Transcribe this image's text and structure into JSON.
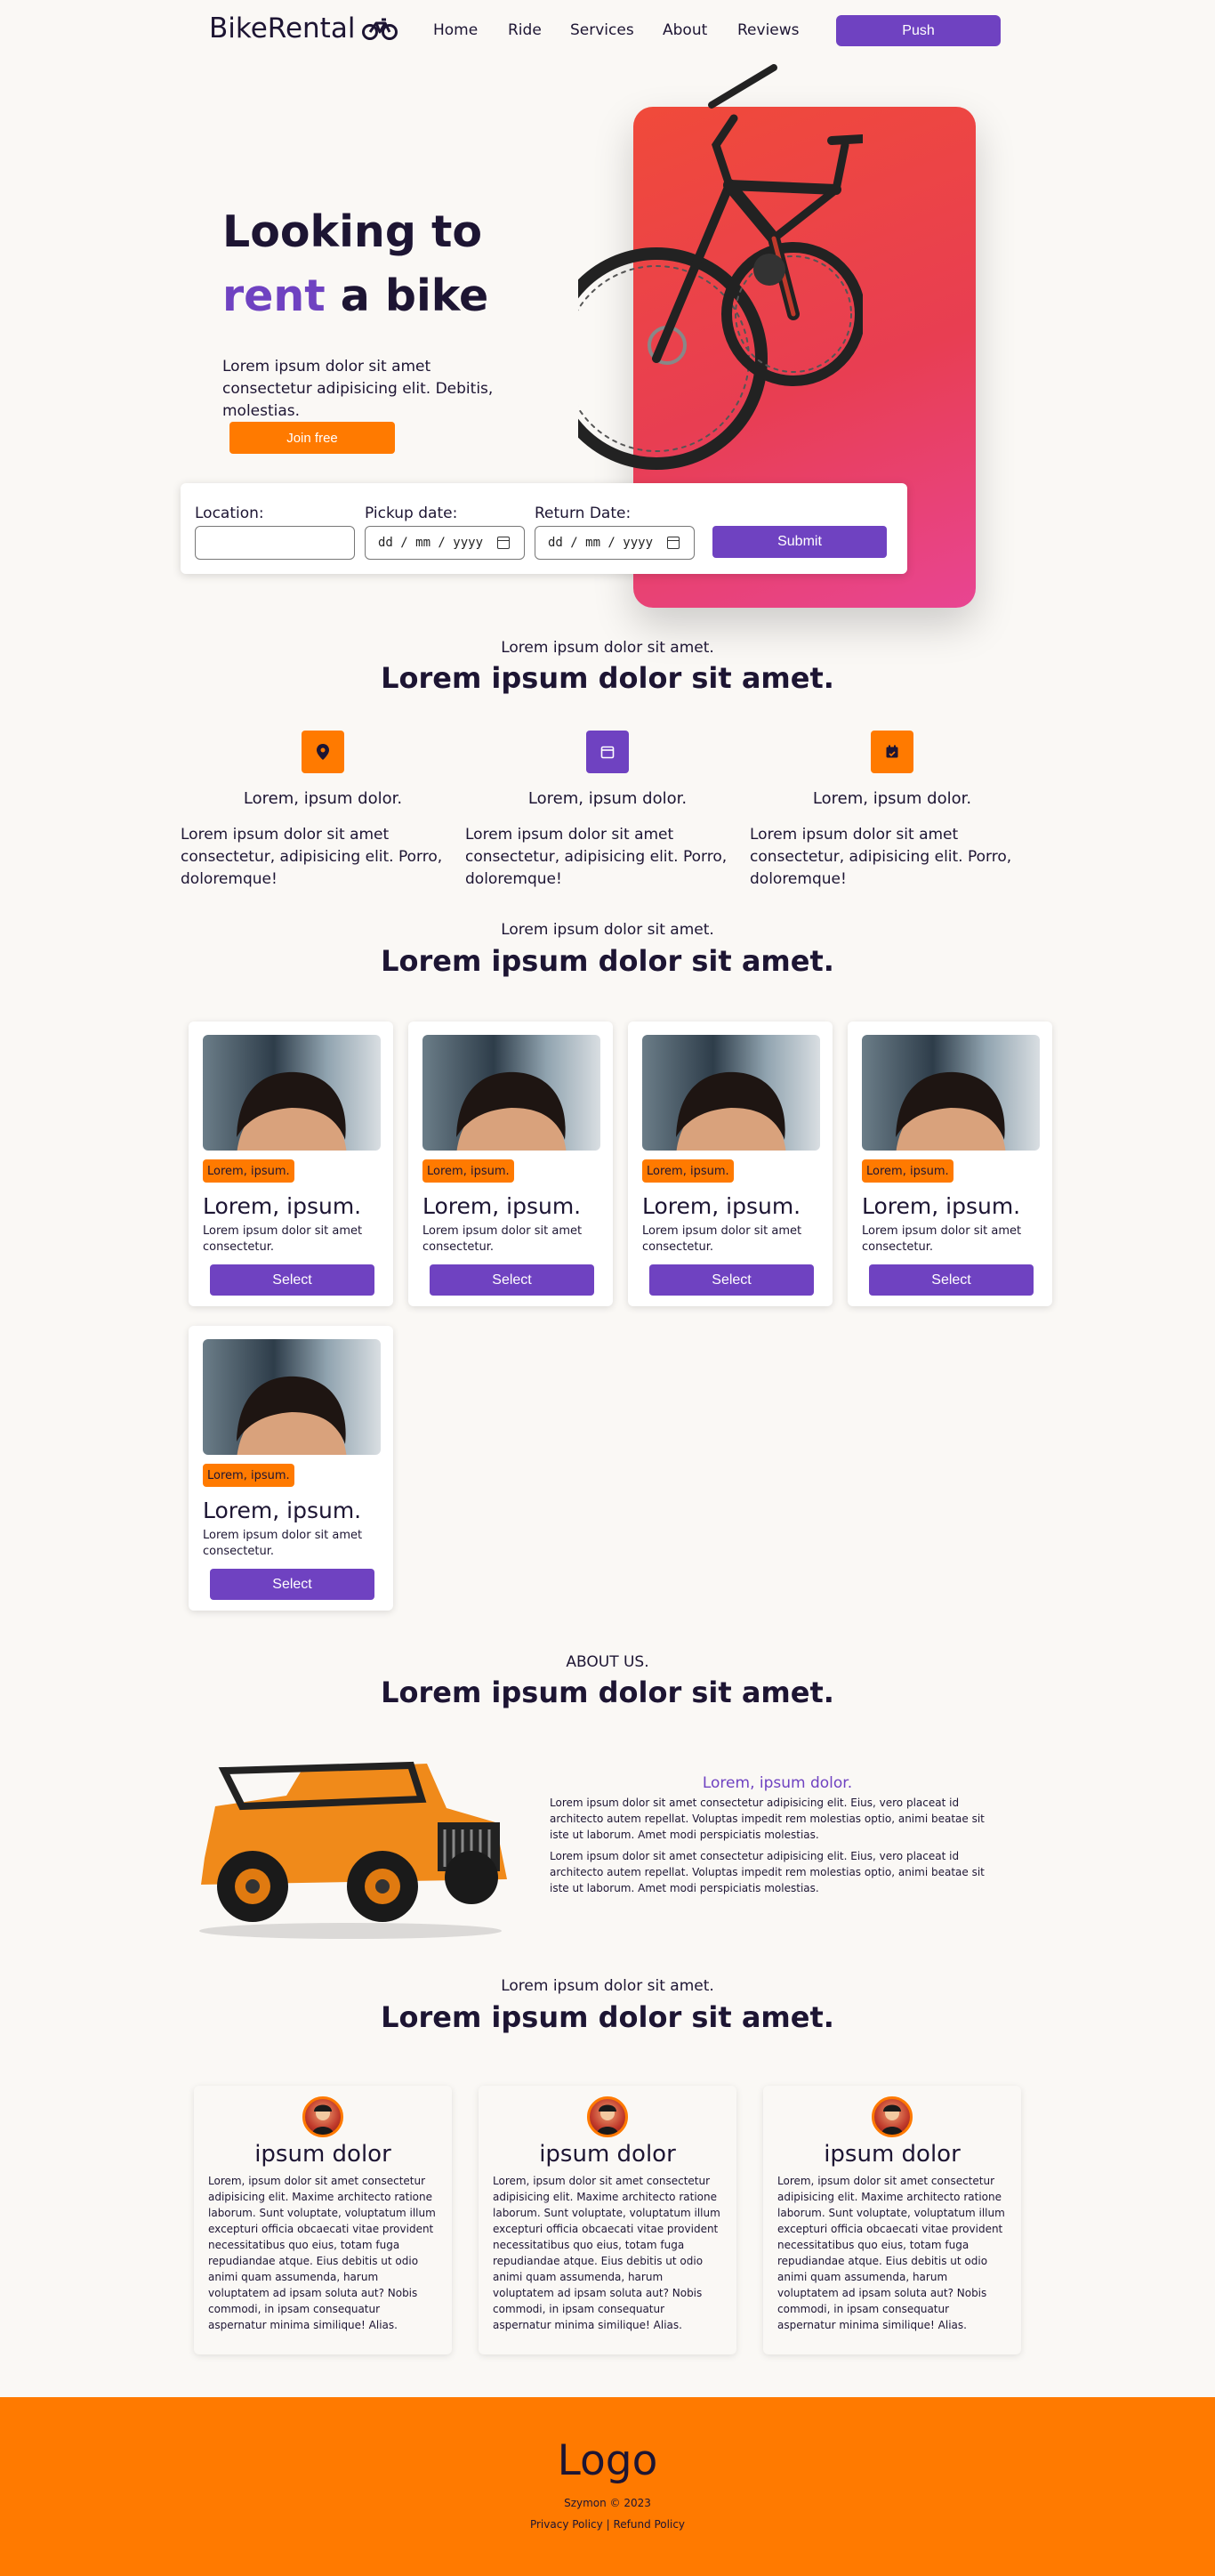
{
  "nav": {
    "brand": "BikeRental",
    "links": [
      "Home",
      "Ride",
      "Services",
      "About",
      "Reviews"
    ],
    "push_label": "Push"
  },
  "hero": {
    "title_line1": "Looking to",
    "title_accent": "rent",
    "title_rest": " a bike",
    "description": "Lorem ipsum dolor sit amet consectetur adipisicing elit. Debitis, molestias.",
    "cta_label": "Join free"
  },
  "booking": {
    "location_label": "Location:",
    "location_value": "",
    "pickup_label": "Pickup date:",
    "pickup_placeholder": "dd / mm / yyyy",
    "return_label": "Return Date:",
    "return_placeholder": "dd / mm / yyyy",
    "submit_label": "Submit"
  },
  "features": {
    "subtitle": "Lorem ipsum dolor sit amet.",
    "title": "Lorem ipsum dolor sit amet.",
    "items": [
      {
        "icon": "location-pin-icon",
        "color": "#ff7a00",
        "title": "Lorem, ipsum dolor.",
        "desc": "Lorem ipsum dolor sit amet consectetur, adipisicing elit. Porro, doloremque!"
      },
      {
        "icon": "calendar-icon",
        "color": "#6f42c1",
        "title": "Lorem, ipsum dolor.",
        "desc": "Lorem ipsum dolor sit amet consectetur, adipisicing elit. Porro, doloremque!"
      },
      {
        "icon": "calendar-check-icon",
        "color": "#ff7a00",
        "title": "Lorem, ipsum dolor.",
        "desc": "Lorem ipsum dolor sit amet consectetur, adipisicing elit. Porro, doloremque!"
      }
    ]
  },
  "rides": {
    "subtitle": "Lorem ipsum dolor sit amet.",
    "title": "Lorem ipsum dolor sit amet.",
    "cards": [
      {
        "tag": "Lorem, ipsum.",
        "title": "Lorem, ipsum.",
        "desc": "Lorem ipsum dolor sit amet consectetur.",
        "button": "Select"
      },
      {
        "tag": "Lorem, ipsum.",
        "title": "Lorem, ipsum.",
        "desc": "Lorem ipsum dolor sit amet consectetur.",
        "button": "Select"
      },
      {
        "tag": "Lorem, ipsum.",
        "title": "Lorem, ipsum.",
        "desc": "Lorem ipsum dolor sit amet consectetur.",
        "button": "Select"
      },
      {
        "tag": "Lorem, ipsum.",
        "title": "Lorem, ipsum.",
        "desc": "Lorem ipsum dolor sit amet consectetur.",
        "button": "Select"
      },
      {
        "tag": "Lorem, ipsum.",
        "title": "Lorem, ipsum.",
        "desc": "Lorem ipsum dolor sit amet consectetur.",
        "button": "Select"
      }
    ]
  },
  "about": {
    "subtitle": "ABOUT US.",
    "title": "Lorem ipsum dolor sit amet.",
    "heading": "Lorem, ipsum dolor.",
    "p1": "Lorem ipsum dolor sit amet consectetur adipisicing elit. Eius, vero placeat id architecto autem repellat. Voluptas impedit rem molestias optio, animi beatae sit iste ut laborum. Amet modi perspiciatis molestias.",
    "p2": "Lorem ipsum dolor sit amet consectetur adipisicing elit. Eius, vero placeat id architecto autem repellat. Voluptas impedit rem molestias optio, animi beatae sit iste ut laborum. Amet modi perspiciatis molestias."
  },
  "reviews": {
    "subtitle": "Lorem ipsum dolor sit amet.",
    "title": "Lorem ipsum dolor sit amet.",
    "items": [
      {
        "name": "ipsum dolor",
        "text": "Lorem, ipsum dolor sit amet consectetur adipisicing elit. Maxime architecto ratione laborum. Sunt voluptate, voluptatum illum excepturi officia obcaecati vitae provident necessitatibus quo eius, totam fuga repudiandae atque. Eius debitis ut odio animi quam assumenda, harum voluptatem ad ipsam soluta aut? Nobis commodi, in ipsam consequatur aspernatur minima similique! Alias."
      },
      {
        "name": "ipsum dolor",
        "text": "Lorem, ipsum dolor sit amet consectetur adipisicing elit. Maxime architecto ratione laborum. Sunt voluptate, voluptatum illum excepturi officia obcaecati vitae provident necessitatibus quo eius, totam fuga repudiandae atque. Eius debitis ut odio animi quam assumenda, harum voluptatem ad ipsam soluta aut? Nobis commodi, in ipsam consequatur aspernatur minima similique! Alias."
      },
      {
        "name": "ipsum dolor",
        "text": "Lorem, ipsum dolor sit amet consectetur adipisicing elit. Maxime architecto ratione laborum. Sunt voluptate, voluptatum illum excepturi officia obcaecati vitae provident necessitatibus quo eius, totam fuga repudiandae atque. Eius debitis ut odio animi quam assumenda, harum voluptatem ad ipsam soluta aut? Nobis commodi, in ipsam consequatur aspernatur minima similique! Alias."
      }
    ]
  },
  "footer": {
    "logo": "Logo",
    "copyright": "Szymon © 2023",
    "privacy": "Privacy Policy",
    "separator": "|",
    "refund": "Refund Policy"
  },
  "colors": {
    "accent": "#6f42c1",
    "orange": "#ff7a00",
    "text": "#1d1533",
    "background": "#faf8f5"
  }
}
